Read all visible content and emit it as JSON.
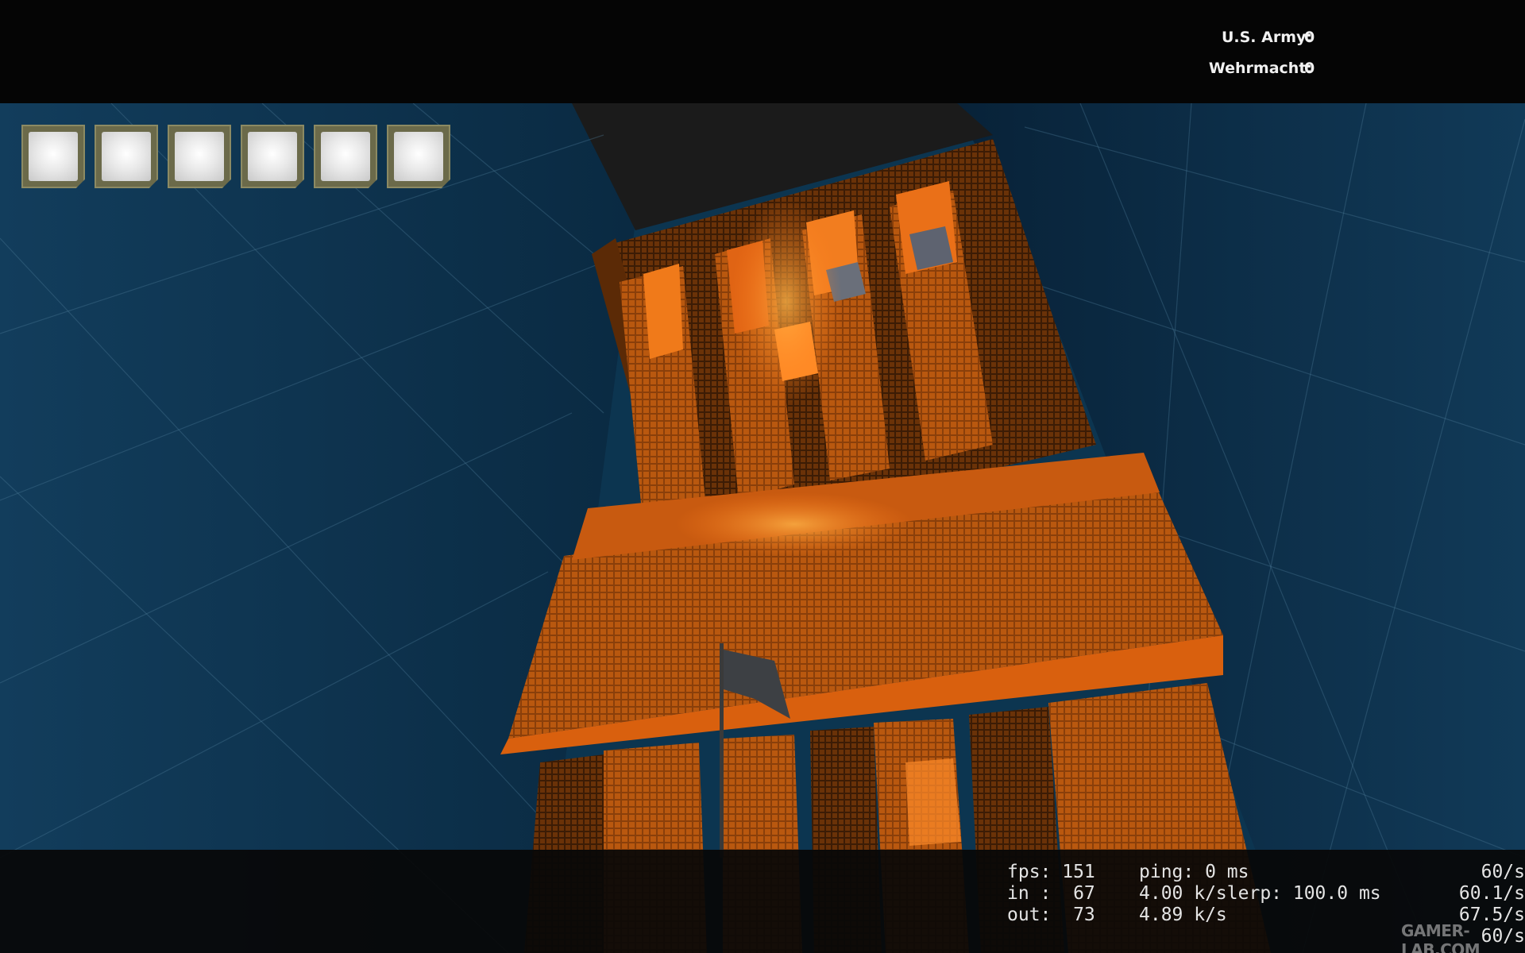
{
  "scoreboard": {
    "teams": [
      {
        "label": "U.S. Army:",
        "score": "0"
      },
      {
        "label": "Wehrmacht:",
        "score": "0"
      }
    ]
  },
  "inventory": {
    "slot_count": 6
  },
  "netgraph": {
    "row1": {
      "a": "fps: 151",
      "b": "ping: 0 ms",
      "c": "60/s"
    },
    "row2": {
      "a": "in :  67",
      "b": "4.00 k/slerp: 100.0 ms",
      "c": "60.1/s"
    },
    "row3": {
      "a": "out:  73",
      "b": "4.89 k/s",
      "c": "67.5/s"
    },
    "row4": {
      "c": "60/s"
    }
  },
  "watermark": "GAMER-LAB.COM",
  "colors": {
    "wall": "#0c3550",
    "orange": "#e1670f",
    "hud_text": "#f1f1f1"
  }
}
